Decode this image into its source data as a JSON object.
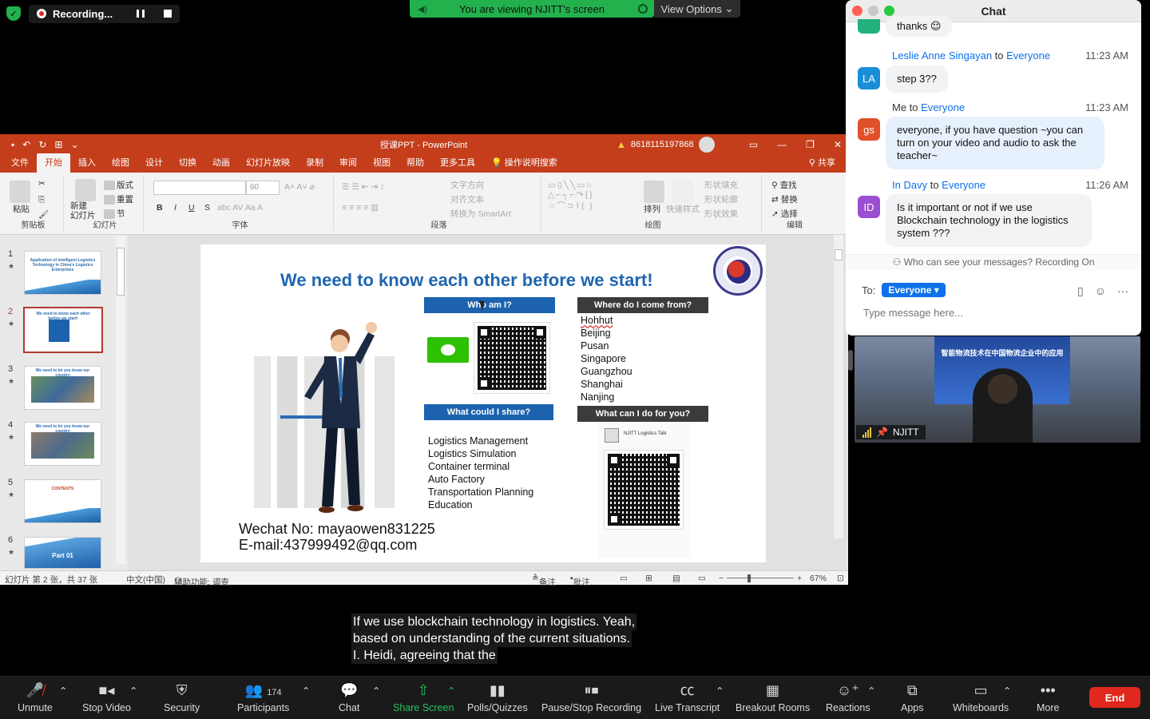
{
  "recording": {
    "label": "Recording..."
  },
  "banner": {
    "viewing": "You are viewing NJITT's screen",
    "view_options": "View Options"
  },
  "ppt": {
    "title": "授课PPT - PowerPoint",
    "account": "8618115197868",
    "tabs": [
      "文件",
      "开始",
      "插入",
      "绘图",
      "设计",
      "切换",
      "动画",
      "幻灯片放映",
      "录制",
      "审阅",
      "视图",
      "帮助",
      "更多工具"
    ],
    "active_tab": "开始",
    "tell_me": "操作说明搜索",
    "share": "共享",
    "ribbon": {
      "paste": "粘贴",
      "clipboard": "剪贴板",
      "new_slide": "新建\n幻灯片",
      "layout": "版式",
      "reset": "重置",
      "section": "节",
      "slides": "幻灯片",
      "font_size": "60",
      "font": "字体",
      "text_direction": "文字方向",
      "align_text": "对齐文本",
      "smartart": "转换为 SmartArt",
      "paragraph": "段落",
      "arrange": "排列",
      "quick_styles": "快速样式",
      "shape_fill": "形状填充",
      "shape_outline": "形状轮廓",
      "shape_effects": "形状效果",
      "drawing": "绘图",
      "find": "查找",
      "replace": "替换",
      "select": "选择",
      "editing": "编辑"
    },
    "thumbnails": [
      {
        "num": "1",
        "title": "Application of Intelligent Logistics Technology in China's Logistics Enterprises"
      },
      {
        "num": "2",
        "title": "We need to know each other before we start!"
      },
      {
        "num": "3",
        "title": "We need to let you know our country"
      },
      {
        "num": "4",
        "title": "We need to let you know our country"
      },
      {
        "num": "5",
        "title": "CONTENTS"
      },
      {
        "num": "6",
        "title": "Part 01"
      }
    ],
    "slide": {
      "title": "We need to know each other before we start!",
      "who_am_i": "Who am I?",
      "where_from": "Where do I come from?",
      "cities": [
        "Hohhut",
        "Beijing",
        "Pusan",
        "Singapore",
        "Guangzhou",
        "Shanghai",
        "Nanjing"
      ],
      "what_share": "What  could I share?",
      "what_do": "What can I do for you?",
      "share_items": [
        "Logistics Management",
        "Logistics Simulation",
        "Container terminal",
        "Auto Factory",
        "Transportation Planning",
        "Education"
      ],
      "njitt_talk": "NJITT Logistics Talk",
      "wechat_no": "Wechat No: mayaowen831225",
      "email": "E-mail:437999492@qq.com"
    },
    "status": {
      "slide_info": "幻灯片 第 2 张，共 37 张",
      "language": "中文(中国)",
      "accessibility": "辅助功能: 调查",
      "notes": "备注",
      "comments": "批注",
      "zoom": "67%"
    }
  },
  "chat": {
    "title": "Chat",
    "messages": [
      {
        "text": "thanks 😌"
      },
      {
        "sender": "Leslie Anne Singayan",
        "to_word": "to",
        "recipient": "Everyone",
        "time": "11:23 AM",
        "initials": "LA",
        "color": "#1a8fd8",
        "text": "step 3??"
      },
      {
        "sender": "Me",
        "to_word": "to",
        "recipient": "Everyone",
        "time": "11:23 AM",
        "initials": "gs",
        "color": "#e0502a",
        "text": "everyone, if you have question ~you can turn on your video and audio to ask the teacher~"
      },
      {
        "sender": "In Davy",
        "to_word": "to",
        "recipient": "Everyone",
        "time": "11:26 AM",
        "initials": "ID",
        "color": "#9b4fd0",
        "text": "Is it important or not if we use Blockchain technology in the logistics system ???"
      }
    ],
    "notice": "Who can see your messages? Recording On",
    "to_label": "To:",
    "to_value": "Everyone",
    "placeholder": "Type message here..."
  },
  "video": {
    "name": "NJITT",
    "screen_title": "智能物流技术在中国物流企业中的应用"
  },
  "captions": [
    "If we use blockchain technology in logistics. Yeah,",
    "based on understanding of the current situations.",
    "I. Heidi, agreeing that the"
  ],
  "toolbar": {
    "unmute": "Unmute",
    "stop_video": "Stop Video",
    "security": "Security",
    "participants": "Participants",
    "participant_count": "174",
    "chat": "Chat",
    "share_screen": "Share Screen",
    "polls": "Polls/Quizzes",
    "pause_rec": "Pause/Stop Recording",
    "transcript": "Live Transcript",
    "breakout": "Breakout Rooms",
    "reactions": "Reactions",
    "apps": "Apps",
    "whiteboards": "Whiteboards",
    "more": "More",
    "end": "End"
  }
}
